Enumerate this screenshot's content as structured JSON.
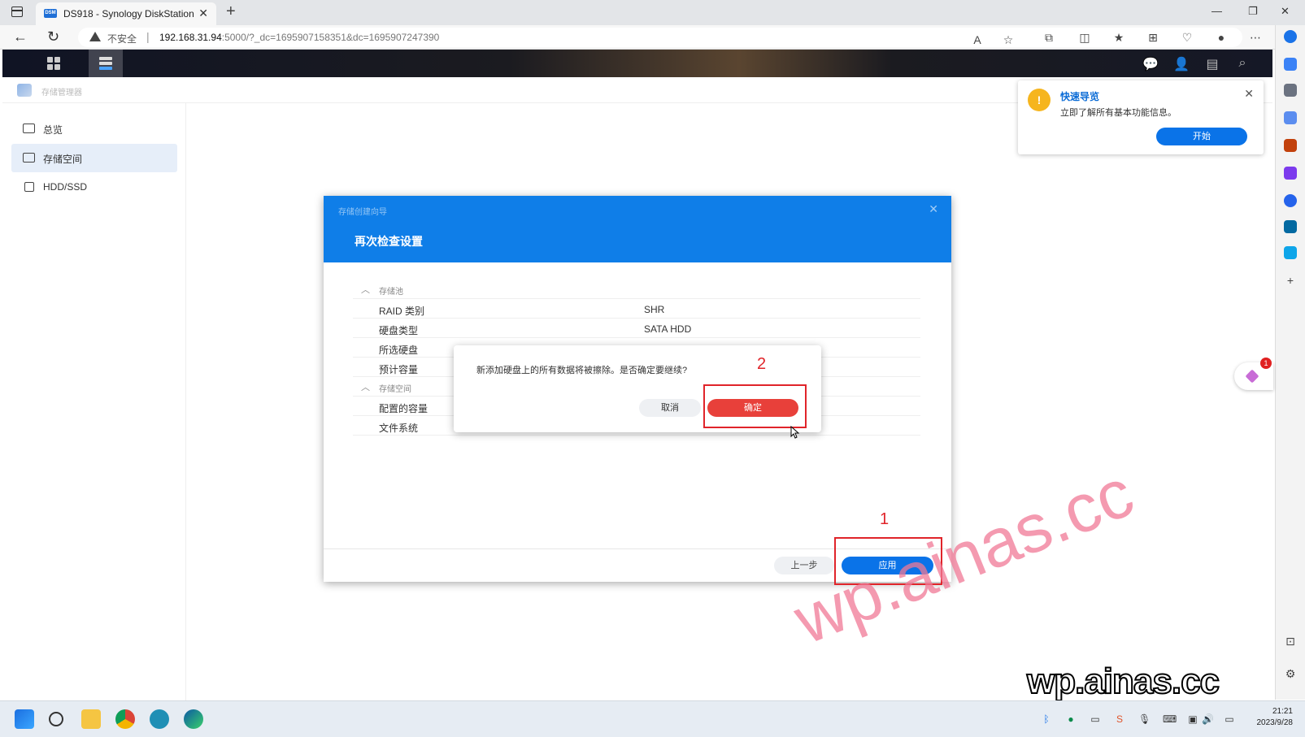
{
  "browser": {
    "tab_title": "DS918 - Synology DiskStation",
    "tab_favicon": "DSM",
    "insecure_label": "不安全",
    "url_host": "192.168.31.94",
    "url_rest": ":5000/?_dc=1695907158351&dc=1695907247390"
  },
  "app": {
    "title": "存储管理器"
  },
  "sidebar": {
    "items": [
      {
        "label": "总览"
      },
      {
        "label": "存储空间"
      },
      {
        "label": "HDD/SSD"
      }
    ]
  },
  "tour": {
    "title": "快速导览",
    "desc": "立即了解所有基本功能信息。",
    "button": "开始"
  },
  "float_badge": "1",
  "wizard": {
    "small_title": "存储创建向导",
    "title": "再次检查设置",
    "section_pool": "存储池",
    "section_volume": "存储空间",
    "rows": [
      {
        "k": "RAID 类别",
        "v": "SHR"
      },
      {
        "k": "硬盘类型",
        "v": "SATA HDD"
      },
      {
        "k": "所选硬盘",
        "v": ""
      },
      {
        "k": "预计容量",
        "v": ""
      }
    ],
    "rows2": [
      {
        "k": "配置的容量",
        "v": ""
      },
      {
        "k": "文件系统",
        "v": ""
      }
    ],
    "prev_button": "上一步",
    "apply_button": "应用"
  },
  "confirm": {
    "message": "新添加硬盘上的所有数据将被擦除。是否确定要继续?",
    "cancel": "取消",
    "ok": "确定"
  },
  "annotations": {
    "one": "1",
    "two": "2"
  },
  "watermark": {
    "big": "wp.ainas.cc",
    "small": "wp.ainas.cc"
  },
  "clock": {
    "time": "21:21",
    "date": "2023/9/28"
  },
  "colors": {
    "dsm_blue": "#0f7ee8",
    "danger_red": "#e8403a",
    "annotation_red": "#e0242a"
  }
}
